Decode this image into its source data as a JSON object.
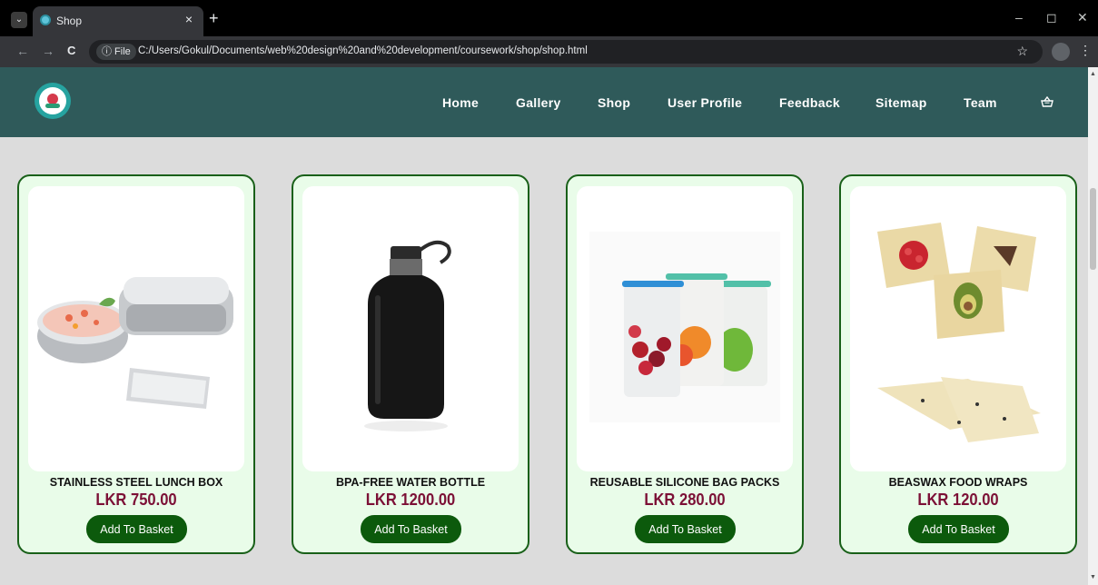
{
  "browser": {
    "tab_title": "Shop",
    "tab_close": "×",
    "new_tab": "+",
    "back": "←",
    "forward": "→",
    "reload": "C",
    "file_chip": "ⓘ File",
    "url": "C:/Users/Gokul/Documents/web%20design%20and%20development/coursework/shop/shop.html",
    "star": "☆",
    "kebab": "⋮",
    "minimize": "–",
    "restore": "◻",
    "close": "✕",
    "tab_search": "⌄"
  },
  "nav": {
    "items": [
      {
        "label": "Home"
      },
      {
        "label": "Gallery"
      },
      {
        "label": "Shop"
      },
      {
        "label": "User Profile"
      },
      {
        "label": "Feedback"
      },
      {
        "label": "Sitemap"
      },
      {
        "label": "Team"
      }
    ],
    "basket_icon": "basket-icon"
  },
  "products": [
    {
      "name": "STAINLESS STEEL LUNCH BOX",
      "price": "LKR 750.00",
      "button": "Add To Basket"
    },
    {
      "name": "BPA-FREE WATER BOTTLE",
      "price": "LKR 1200.00",
      "button": "Add To Basket"
    },
    {
      "name": "REUSABLE SILICONE BAG PACKS",
      "price": "LKR 280.00",
      "button": "Add To Basket"
    },
    {
      "name": "BEASWAX FOOD WRAPS",
      "price": "LKR 120.00",
      "button": "Add To Basket"
    }
  ],
  "colors": {
    "header_bg": "#2f5a5a",
    "card_bg": "#e9fce9",
    "card_border": "#196019",
    "price": "#7c1036",
    "button_bg": "#0c5a0c",
    "page_bg": "#dcdcdc"
  }
}
